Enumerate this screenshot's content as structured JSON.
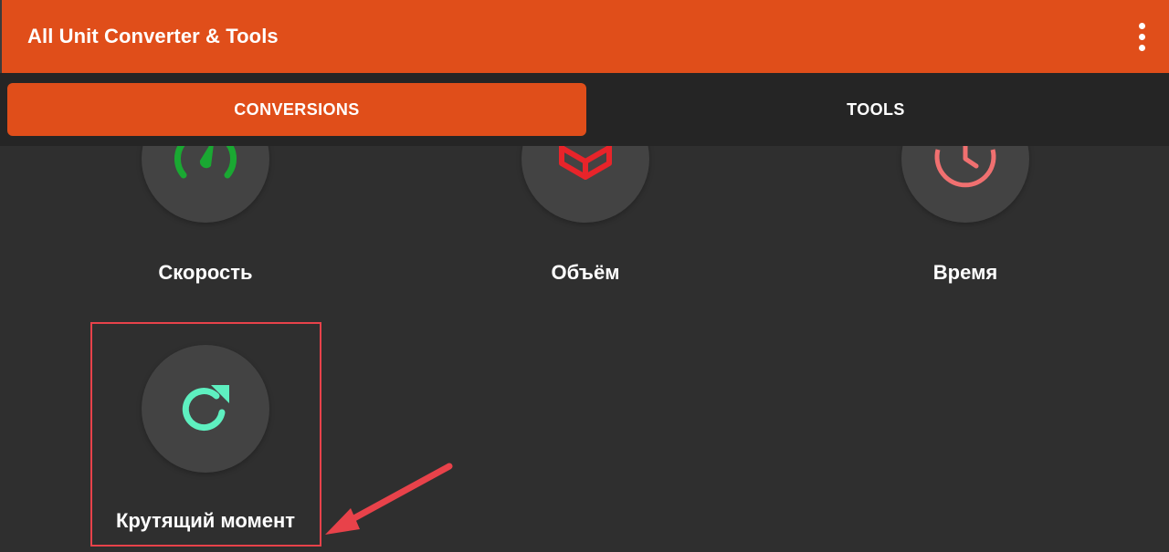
{
  "app": {
    "title": "All Unit Converter & Tools",
    "accent_color": "#e04e1a"
  },
  "header": {
    "menu_icon": "more-vert-icon"
  },
  "tabs": [
    {
      "label": "CONVERSIONS",
      "active": true
    },
    {
      "label": "TOOLS",
      "active": false
    }
  ],
  "categories": [
    {
      "label": "Скорость",
      "icon": "speedometer-icon",
      "icon_color": "#1aa832"
    },
    {
      "label": "Объём",
      "icon": "cube-icon",
      "icon_color": "#e8242a"
    },
    {
      "label": "Время",
      "icon": "clock-icon",
      "icon_color": "#f07070"
    },
    {
      "label": "Крутящий момент",
      "icon": "rotate-icon",
      "icon_color": "#5ef0c0"
    }
  ],
  "annotation": {
    "highlight_color": "#e8424a"
  }
}
